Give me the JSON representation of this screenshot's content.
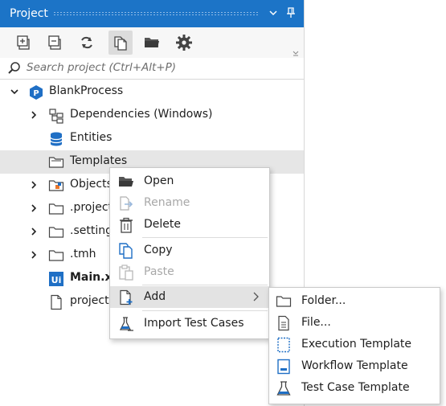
{
  "panel": {
    "title": "Project",
    "search_placeholder": "Search project (Ctrl+Alt+P)",
    "toolbar": [
      "expand-all-icon",
      "collapse-all-icon",
      "refresh-icon",
      "show-all-files-icon",
      "open-folder-icon",
      "settings-icon"
    ]
  },
  "tree": {
    "root": "BlankProcess",
    "items": [
      {
        "label": "Dependencies (Windows)"
      },
      {
        "label": "Entities"
      },
      {
        "label": "Templates"
      },
      {
        "label": "Objects"
      },
      {
        "label": ".project"
      },
      {
        "label": ".setting"
      },
      {
        "label": ".tmh"
      },
      {
        "label": "Main.xa"
      },
      {
        "label": "project."
      }
    ]
  },
  "context_menu": {
    "open": "Open",
    "rename": "Rename",
    "delete": "Delete",
    "copy": "Copy",
    "paste": "Paste",
    "add": "Add",
    "import_test_cases": "Import Test Cases"
  },
  "add_submenu": {
    "folder": "Folder...",
    "file": "File...",
    "execution_template": "Execution Template",
    "workflow_template": "Workflow Template",
    "test_case_template": "Test Case Template"
  },
  "colors": {
    "titlebar": "#1c74c7",
    "selection": "#e6e6e6",
    "menu_highlight": "#e3e3e3",
    "accent_blue": "#1f6fc5"
  }
}
